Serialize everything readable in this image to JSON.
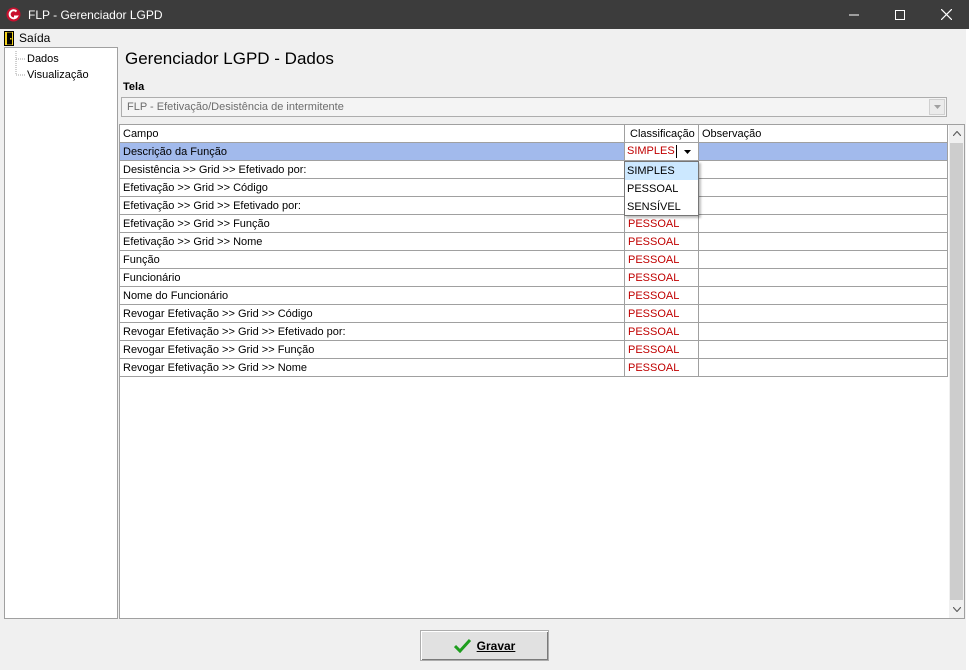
{
  "window": {
    "title": "FLP - Gerenciador LGPD",
    "app_icon": "flp-logo-icon",
    "controls": [
      "minimize-icon",
      "maximize-icon",
      "close-icon"
    ]
  },
  "menu": {
    "exit_label": "Saída",
    "exit_icon": "exit-door-icon"
  },
  "tree": {
    "items": [
      {
        "label": "Dados"
      },
      {
        "label": "Visualização"
      }
    ]
  },
  "main": {
    "title": "Gerenciador LGPD - Dados",
    "tela_label": "Tela",
    "tela_value": "FLP - Efetivação/Desistência de intermitente"
  },
  "grid": {
    "columns": [
      "Campo",
      "Classificação",
      "Observação"
    ],
    "rows": [
      {
        "campo": "Descrição da Função",
        "classificacao": "SIMPLES",
        "observacao": ""
      },
      {
        "campo": "Desistência >> Grid >> Efetivado por:",
        "classificacao": "",
        "observacao": ""
      },
      {
        "campo": "Efetivação >> Grid >> Código",
        "classificacao": "",
        "observacao": ""
      },
      {
        "campo": "Efetivação >> Grid >> Efetivado por:",
        "classificacao": "",
        "observacao": ""
      },
      {
        "campo": "Efetivação >> Grid >> Função",
        "classificacao": "PESSOAL",
        "observacao": ""
      },
      {
        "campo": "Efetivação >> Grid >> Nome",
        "classificacao": "PESSOAL",
        "observacao": ""
      },
      {
        "campo": "Função",
        "classificacao": "PESSOAL",
        "observacao": ""
      },
      {
        "campo": "Funcionário",
        "classificacao": "PESSOAL",
        "observacao": ""
      },
      {
        "campo": "Nome do Funcionário",
        "classificacao": "PESSOAL",
        "observacao": ""
      },
      {
        "campo": "Revogar Efetivação >> Grid >> Código",
        "classificacao": "PESSOAL",
        "observacao": ""
      },
      {
        "campo": "Revogar Efetivação >> Grid >> Efetivado por:",
        "classificacao": "PESSOAL",
        "observacao": ""
      },
      {
        "campo": "Revogar Efetivação >> Grid >> Função",
        "classificacao": "PESSOAL",
        "observacao": ""
      },
      {
        "campo": "Revogar Efetivação >> Grid >> Nome",
        "classificacao": "PESSOAL",
        "observacao": ""
      }
    ],
    "editor_value": "SIMPLES",
    "dropdown_options": [
      "SIMPLES",
      "PESSOAL",
      "SENSÍVEL"
    ],
    "dropdown_highlighted": "SIMPLES"
  },
  "footer": {
    "save_label": "Gravar",
    "save_icon": "checkmark-icon"
  },
  "colors": {
    "titlebar": "#3c3c3c",
    "selection": "#a2baec",
    "classification_text": "#c00000",
    "dropdown_highlight": "#cce8ff",
    "check_green": "#1e9e1e"
  }
}
